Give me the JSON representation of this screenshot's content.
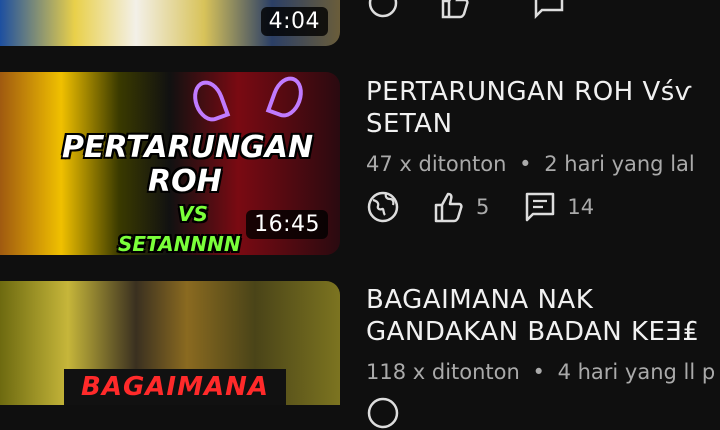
{
  "videos": [
    {
      "duration": "4:04"
    },
    {
      "thumbnail_text": [
        "PERTARUNGAN",
        "ROH",
        "VS",
        "SETANNNN"
      ],
      "duration": "16:45",
      "title_line1": "PERTARUNGAN ROH Vśѵ",
      "title_line2": "SETAN",
      "views": "47 x ditonton",
      "separator": "•",
      "uploaded": "2 hari yang lal",
      "likes": "5",
      "comments": "14"
    },
    {
      "thumbnail_text": "BAGAIMANA",
      "title_line1": "BAGAIMANA NAK",
      "title_line2": "GANDAKAN BADAN KEƎ₤",
      "views": "118 x ditonton",
      "separator": "•",
      "uploaded": "4 hari yang ll p"
    }
  ],
  "icons": {
    "visibility": "globe-icon",
    "like": "thumb-up-icon",
    "comment": "comment-icon"
  }
}
